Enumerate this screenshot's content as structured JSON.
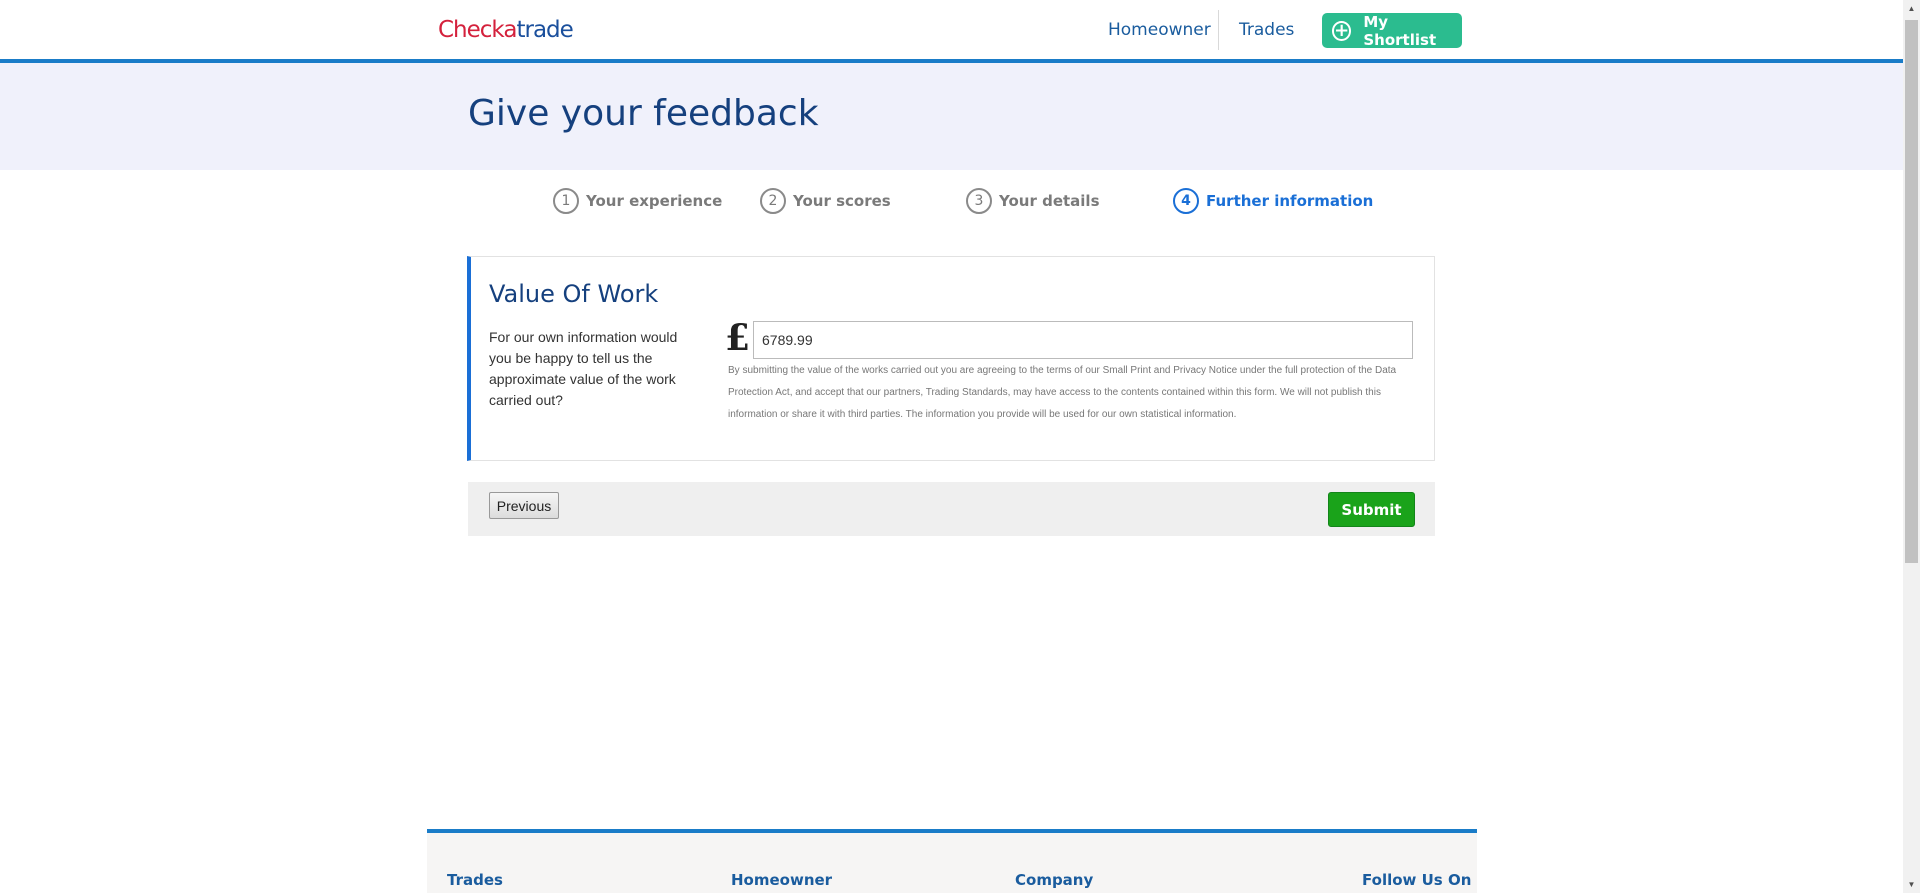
{
  "header": {
    "logo_part1": "Check",
    "logo_part2": "a",
    "logo_part3": "trade",
    "nav_homeowner": "Homeowner",
    "nav_trades": "Trades",
    "shortlist_label": "My Shortlist"
  },
  "banner": {
    "title": "Give your feedback"
  },
  "steps": [
    {
      "num": "1",
      "label": "Your experience",
      "active": false
    },
    {
      "num": "2",
      "label": "Your scores",
      "active": false
    },
    {
      "num": "3",
      "label": "Your details",
      "active": false
    },
    {
      "num": "4",
      "label": "Further information",
      "active": true
    }
  ],
  "panel": {
    "title": "Value Of Work",
    "question": "For our own information would you be happy to tell us the approximate value of the work carried out?",
    "currency_symbol": "£",
    "value": "6789.99",
    "disclaimer": "By submitting the value of the works carried out you are agreeing to the terms of our Small Print and Privacy Notice under the full protection of the Data Protection Act, and accept that our partners, Trading Standards, may have access to the contents contained within this form. We will not publish this information or share it with third parties. The information you provide will be used for our own statistical information."
  },
  "actions": {
    "previous_label": "Previous",
    "submit_label": "Submit"
  },
  "footer": {
    "col_trades": "Trades",
    "col_homeowner": "Homeowner",
    "col_company": "Company",
    "col_follow": "Follow Us On"
  },
  "colors": {
    "brand_blue": "#1a7cc8",
    "title_blue": "#15407e",
    "active_step": "#1a6fd6",
    "shortlist_green": "#2bbc8f",
    "submit_green": "#1aa31a",
    "logo_red": "#d4213c"
  }
}
